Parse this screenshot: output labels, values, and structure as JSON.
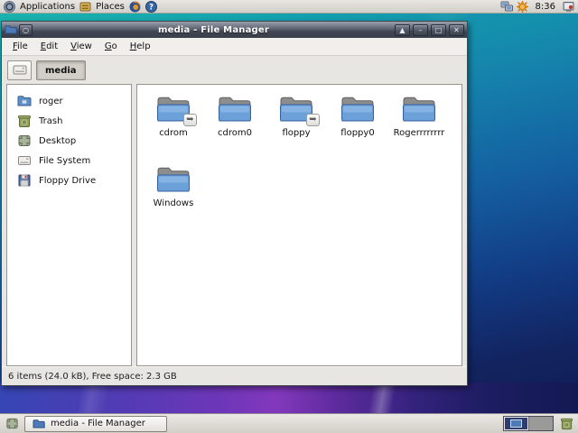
{
  "top_panel": {
    "applications_label": "Applications",
    "places_label": "Places",
    "clock": "8:36"
  },
  "window": {
    "title": "media - File Manager",
    "titlebar_buttons": {
      "options": "○",
      "shade": "▲",
      "minimize": "–",
      "maximize": "□",
      "close": "✕"
    },
    "menu_items": [
      {
        "label": "File"
      },
      {
        "label": "Edit"
      },
      {
        "label": "View"
      },
      {
        "label": "Go"
      },
      {
        "label": "Help"
      }
    ],
    "pathbar": {
      "current_folder": "media"
    },
    "sidebar_items": [
      {
        "label": "roger"
      },
      {
        "label": "Trash"
      },
      {
        "label": "Desktop"
      },
      {
        "label": "File System"
      },
      {
        "label": "Floppy Drive"
      }
    ],
    "files": [
      {
        "name": "cdrom",
        "symlink": true
      },
      {
        "name": "cdrom0",
        "symlink": false
      },
      {
        "name": "floppy",
        "symlink": true
      },
      {
        "name": "floppy0",
        "symlink": false
      },
      {
        "name": "Rogerrrrrrrr",
        "symlink": false
      },
      {
        "name": "Windows",
        "symlink": false
      }
    ],
    "symlink_emblem": "➥",
    "statusbar_text": "6 items (24.0 kB), Free space: 2.3 GB"
  },
  "taskbar": {
    "task_label": "media - File Manager",
    "workspace_count": 2
  },
  "colors": {
    "folder_blue": "#5d8fc6",
    "desktop_teal": "#1cb7ac",
    "desktop_navy": "#101a4e",
    "desktop_purple": "#8338bc",
    "titlebar_dark": "#414652"
  }
}
